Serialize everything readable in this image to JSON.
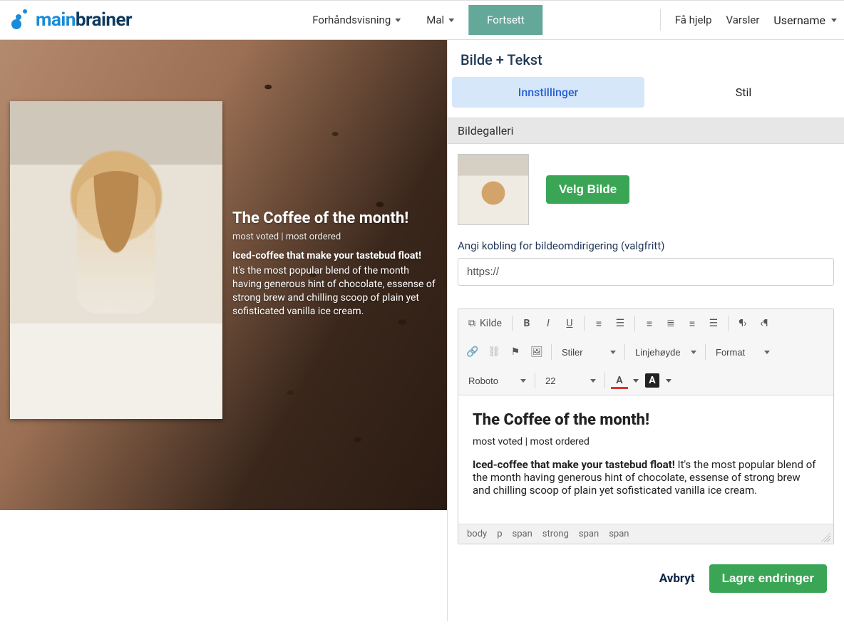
{
  "header": {
    "logo_main": "main",
    "logo_sub": "brainer",
    "nav_preview": "Forhåndsvisning",
    "nav_template": "Mal",
    "nav_continue": "Fortsett",
    "nav_help": "Få hjelp",
    "nav_alerts": "Varsler",
    "username": "Username"
  },
  "canvas": {
    "title": "The Coffee of the month!",
    "subtitle": "most voted | most ordered",
    "lead": "Iced-coffee that make your tastebud float!",
    "body": "It's the most popular blend of the month having generous hint of chocolate, essense of strong brew and chilling scoop of plain yet sofisticated vanilla ice cream."
  },
  "panel": {
    "title": "Bilde + Tekst",
    "tab_settings": "Innstillinger",
    "tab_style": "Stil",
    "section_gallery": "Bildegalleri",
    "choose_image": "Velg Bilde",
    "redirect_label": "Angi kobling for bildeomdirigering (valgfritt)",
    "redirect_value": "https://",
    "cancel": "Avbryt",
    "save": "Lagre endringer"
  },
  "toolbar": {
    "source": "Kilde",
    "styles": "Stiler",
    "lineheight": "Linjehøyde",
    "format": "Format",
    "font": "Roboto",
    "size": "22"
  },
  "editor": {
    "heading": "The Coffee of the month!",
    "sub": "most voted | most ordered",
    "bold": "Iced-coffee that make your tastebud float!",
    "rest": " It's the most popular blend of the month having generous hint of chocolate, essense of strong brew and chilling scoop of plain yet sofisticated vanilla ice cream.",
    "path": [
      "body",
      "p",
      "span",
      "strong",
      "span",
      "span"
    ]
  }
}
